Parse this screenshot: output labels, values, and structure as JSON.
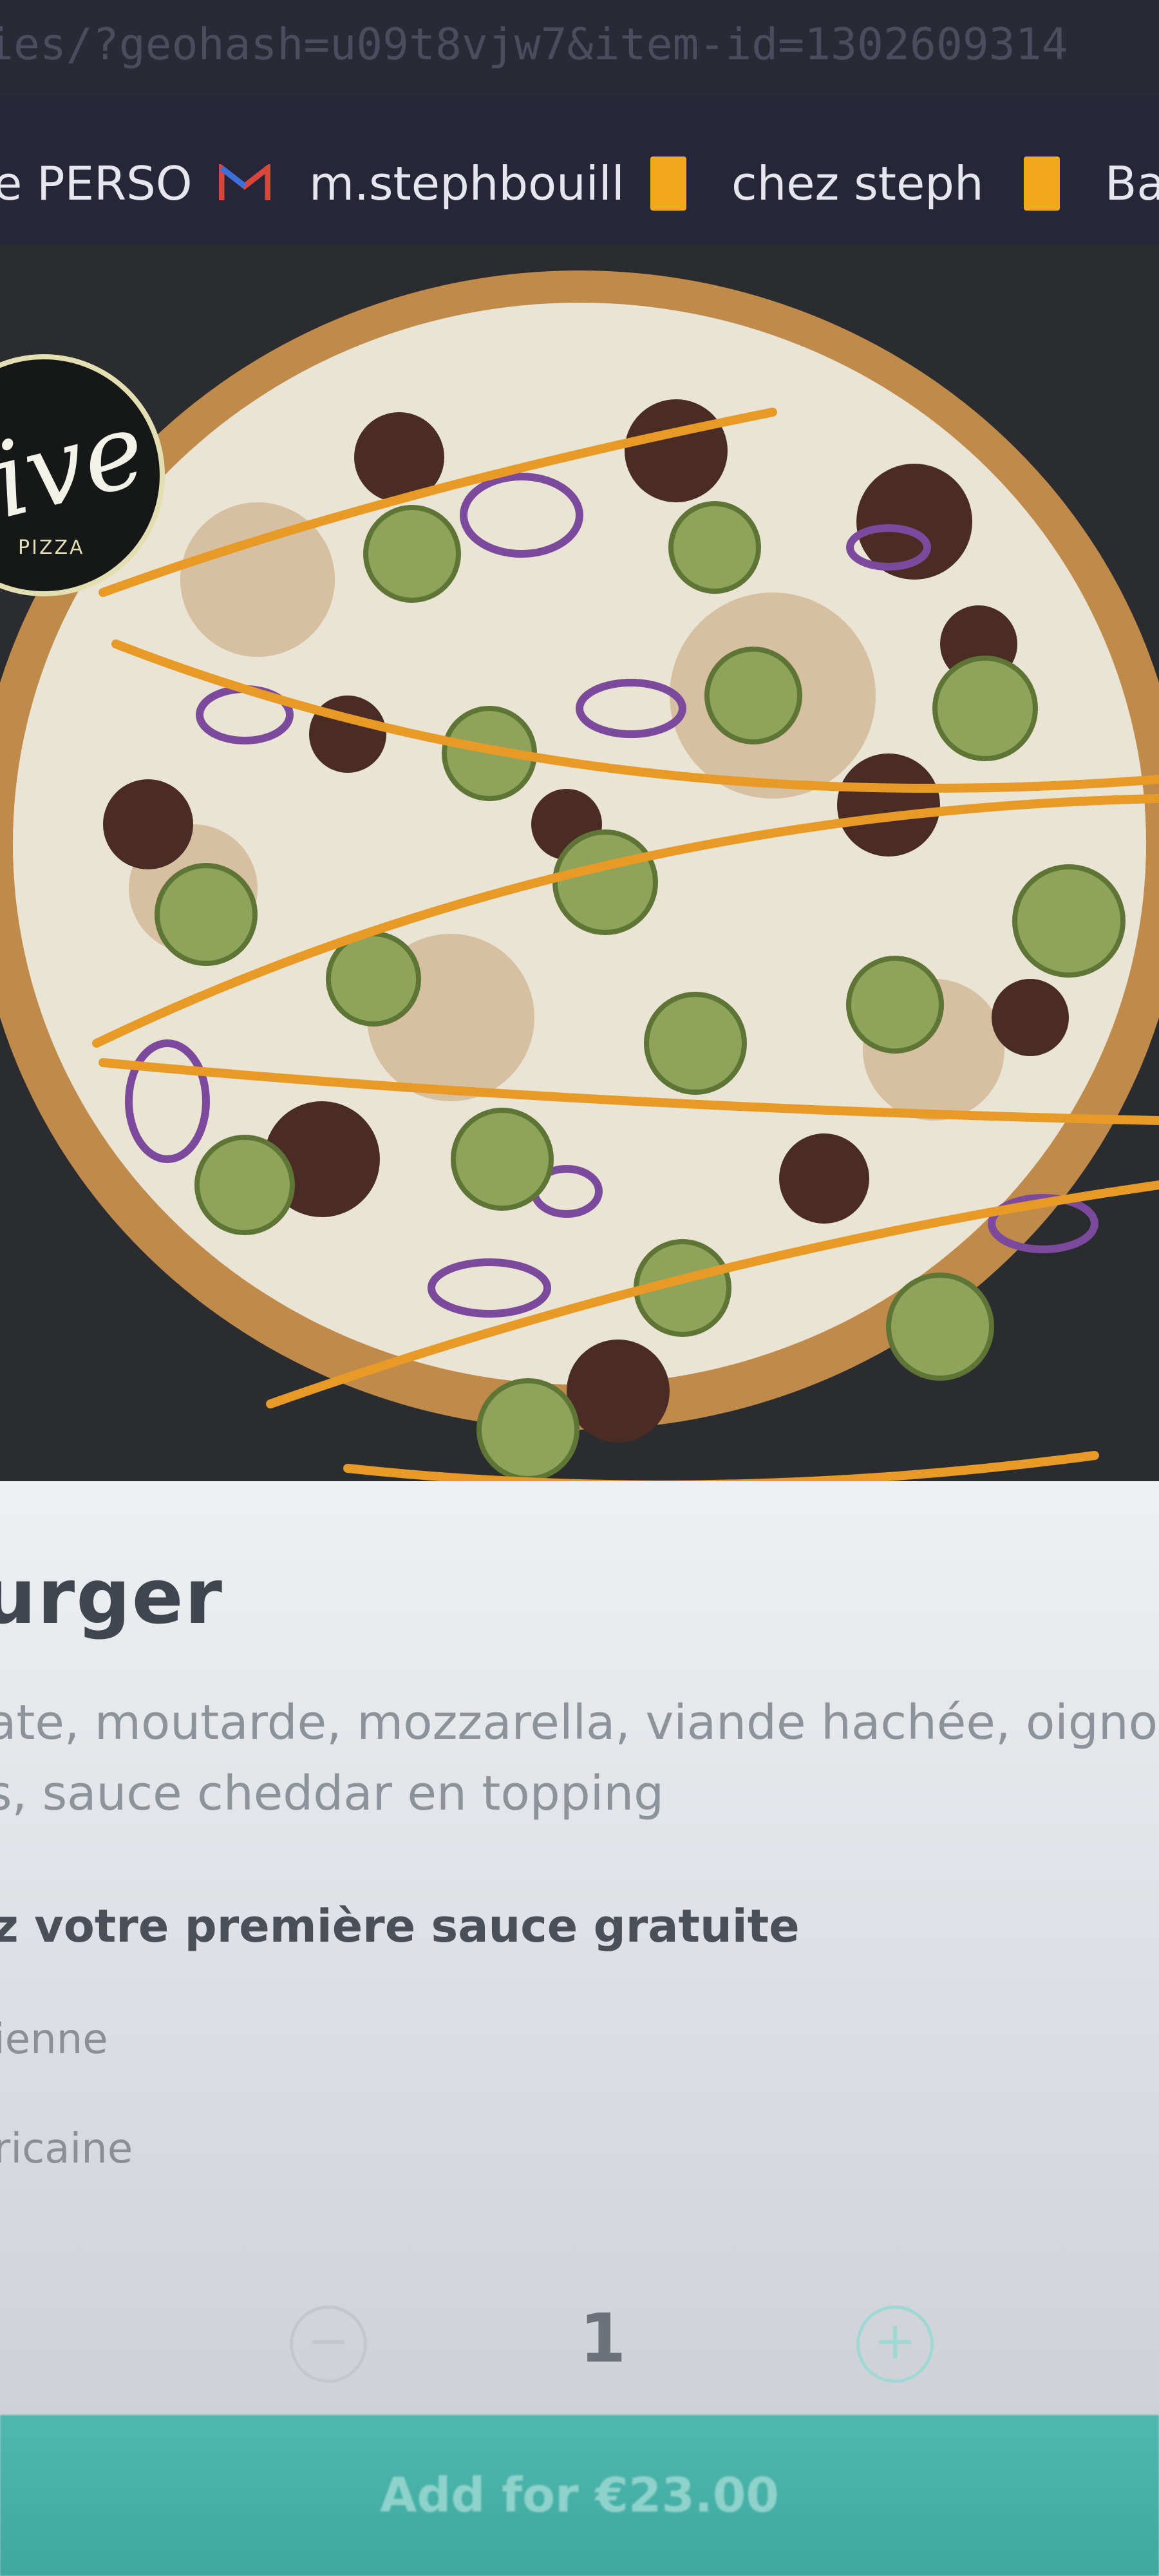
{
  "browser": {
    "url_fragment": "ies/?geohash=u09t8vjw7&item-id=1302609314",
    "bookmarks": [
      {
        "label": "e PERSO",
        "icon": "none"
      },
      {
        "label": "m.stephbouill",
        "icon": "gmail-icon"
      },
      {
        "label": "chez steph",
        "icon": "folder-icon"
      },
      {
        "label": "Ba",
        "icon": "folder-icon"
      }
    ]
  },
  "hero": {
    "logo_text": "ive",
    "logo_subtext": "PIZZA"
  },
  "product": {
    "title": "urger",
    "description": "ate, moutarde, mozzarella, viande hachée, oigno\ns, sauce cheddar en topping",
    "sauce_heading": "z votre première sauce gratuite",
    "options": [
      "ienne",
      "ricaine"
    ],
    "quantity": "1",
    "minus_symbol": "−",
    "plus_symbol": "+",
    "add_button_label": "Add for €23.00"
  },
  "colors": {
    "accent": "#3ea89f",
    "bookmark_folder": "#f2a81a",
    "browser_bar": "#272538"
  }
}
